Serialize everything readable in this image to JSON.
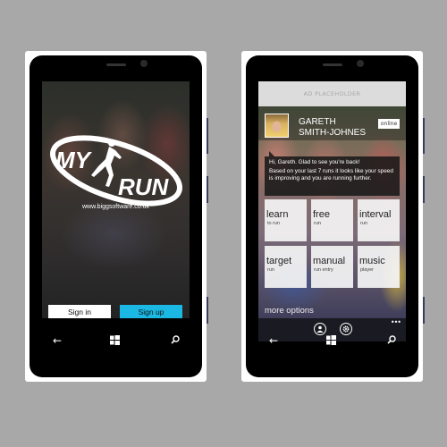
{
  "login_screen": {
    "logo_text_top": "MY",
    "logo_text_bottom": "RUN",
    "url": "www.biggsoftware.co.uk",
    "sign_in_label": "Sign in",
    "sign_up_label": "Sign up",
    "sign_up_color": "#1ab8e3"
  },
  "home_screen": {
    "ad_label": "AD PLACEHOLDER",
    "user": {
      "first_name": "GARETH",
      "last_name": "SMITH-JOHNES",
      "status": "online"
    },
    "message": {
      "greeting": "Hi, Gareth. Glad to see you're back!",
      "body": "Based on your last 7 runs it looks like your speed is improving and you are running further."
    },
    "tiles": [
      {
        "title": "learn",
        "subtitle": "to run"
      },
      {
        "title": "free",
        "subtitle": "run"
      },
      {
        "title": "interval",
        "subtitle": "run"
      },
      {
        "title": "target",
        "subtitle": "run"
      },
      {
        "title": "manual",
        "subtitle": "run entry"
      },
      {
        "title": "music",
        "subtitle": "player"
      }
    ],
    "more_options_label": "more options",
    "appbar": {
      "buttons": [
        "profile-icon",
        "settings-icon"
      ],
      "overflow": "•••"
    }
  },
  "navbar": {
    "back": "←",
    "start": "windows-icon",
    "search": "⌕"
  }
}
